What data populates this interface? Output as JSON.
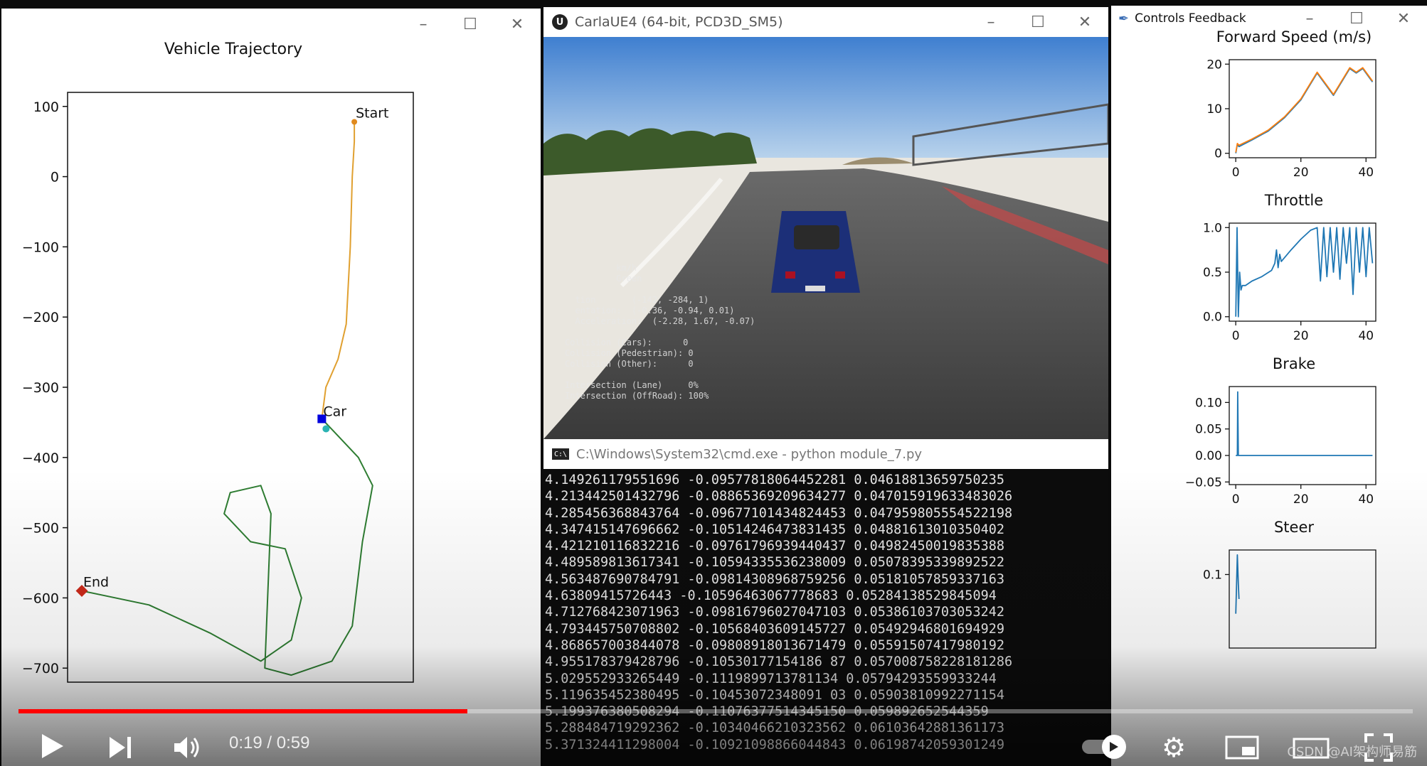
{
  "trajectory_window": {
    "chart_data": {
      "type": "line",
      "title": "Vehicle Trajectory",
      "xlim": [
        -125,
        45
      ],
      "ylim": [
        -720,
        120
      ],
      "yticks": [
        100,
        0,
        -100,
        -200,
        -300,
        -400,
        -500,
        -600,
        -700
      ],
      "tick_labels": [
        "100",
        "0",
        "−100",
        "−200",
        "−300",
        "−400",
        "−500",
        "−600",
        "−700"
      ],
      "annotations": {
        "start": "Start",
        "car": "Car",
        "end": "End"
      },
      "series": [
        {
          "color": "#2e7d32",
          "x": [
            -118,
            -85,
            -55,
            -30,
            -15,
            -10,
            -18,
            -35,
            -48,
            -45,
            -30,
            -25,
            -28,
            -15,
            5,
            15,
            20,
            25,
            18,
            5,
            0
          ],
          "y": [
            -590,
            -610,
            -650,
            -690,
            -660,
            -600,
            -530,
            -520,
            -480,
            -450,
            -440,
            -480,
            -700,
            -710,
            -690,
            -640,
            -520,
            -440,
            -400,
            -360,
            -345
          ]
        },
        {
          "color": "#e0a030",
          "x": [
            0,
            2,
            8,
            12,
            14,
            15,
            16,
            16
          ],
          "y": [
            -345,
            -300,
            -260,
            -210,
            -100,
            0,
            50,
            78
          ]
        }
      ],
      "start_point": [
        16,
        78
      ],
      "car_point": [
        0,
        -345
      ],
      "end_point": [
        -118,
        -590
      ]
    }
  },
  "carla_window": {
    "title": "CarlaUE4 (64-bit, PCD3D_SM5)",
    "logo": "U",
    "hud_lines": "          km/h\n          Green\n\n  tion       (-142, -284, 1)\n  entation:  (-0.36, -0.94, 0.01)\n  Acceleration:  (-2.28, 1.67, -0.07)\n\nCollision (Cars):      0\nCollision (Pedestrian): 0\nCollision (Other):      0\n\nIntersection (Lane)     0%\nIntersection (OffRoad): 100%"
  },
  "cmd_window": {
    "title": "C:\\Windows\\System32\\cmd.exe - python  module_7.py",
    "lines": [
      "4.149261179551696 -0.09577818064452281 0.04618813659750235",
      "4.213442501432796 -0.08865369209634277 0.047015919633483026",
      "4.285456368843764 -0.09677101434824453 0.047959805554522198",
      "4.347415147696662 -0.10514246473831435 0.04881613010350402",
      "4.421210116832216 -0.09761796939440437 0.04982450019835388",
      "4.489589813617341 -0.10594335536238009 0.05078395339892522",
      "4.563487690784791 -0.09814308968759256 0.05181057859337163",
      "4.63809415726443 -0.10596463067778683 0.05284138529845094",
      "4.712768423071963 -0.09816796027047103 0.05386103703053242",
      "4.793445750708802 -0.10568403609145727 0.05492946801694929",
      "4.868657003844078 -0.09808918013671479 0.05591507417980192",
      "4.955178379428796 -0.10530177154186 87 0.057008758228181286",
      "5.029552933265449 -0.1119899713781134 0.05794293559933244",
      "5.119635452380495 -0.10453072348091 03 0.05903810992271154",
      "5.199376380508294 -0.11076377514345150 0.059892652544359",
      "5.288484719292362 -0.10340466210323562 0.06103642881361173",
      "5.371324411298004 -0.10921098866044843 0.06198742059301249"
    ]
  },
  "feedback_window": {
    "title": "Controls Feedback",
    "charts": [
      {
        "type": "line",
        "title": "Forward Speed (m/s)",
        "xlim": [
          -2,
          43
        ],
        "ylim": [
          -1,
          21
        ],
        "xticks": [
          "0",
          "20",
          "40"
        ],
        "yticks": [
          "20",
          "10",
          "0"
        ],
        "ytick_values": [
          20,
          10,
          0
        ],
        "series": [
          {
            "color": "#1f77b4",
            "x": [
              0,
              0.5,
              1,
              5,
              10,
              15,
              20,
              25,
              30,
              35,
              37,
              39,
              41,
              42
            ],
            "y": [
              0,
              2,
              1.5,
              3,
              5,
              8,
              12,
              18,
              13,
              19,
              18,
              19,
              17,
              16
            ]
          },
          {
            "color": "#ff7f0e",
            "x": [
              0,
              0.5,
              1,
              5,
              10,
              15,
              20,
              25,
              30,
              35,
              37,
              39,
              41,
              42
            ],
            "y": [
              0.2,
              2.2,
              1.8,
              3.2,
              5.2,
              8.2,
              12.2,
              18.2,
              13.2,
              19.2,
              18.2,
              19.2,
              17.2,
              16.2
            ]
          }
        ]
      },
      {
        "type": "line",
        "title": "Throttle",
        "xlim": [
          -2,
          43
        ],
        "ylim": [
          -0.05,
          1.05
        ],
        "xticks": [
          "0",
          "20",
          "40"
        ],
        "yticks": [
          "1.0",
          "0.5",
          "0.0"
        ],
        "ytick_values": [
          1.0,
          0.5,
          0.0
        ],
        "series": [
          {
            "color": "#1f77b4",
            "x": [
              0,
              0.4,
              0.8,
              1.2,
              1.6,
              2,
              3,
              5,
              8,
              11,
              12,
              12.5,
              13,
              13.5,
              14,
              17,
              20,
              23,
              25,
              26,
              27,
              28,
              29,
              30,
              31,
              32,
              33,
              34,
              35,
              36,
              37,
              38,
              39,
              40,
              41,
              42
            ],
            "y": [
              0,
              1.0,
              0.0,
              0.5,
              0.3,
              0.35,
              0.35,
              0.4,
              0.45,
              0.52,
              0.6,
              0.75,
              0.55,
              0.7,
              0.62,
              0.75,
              0.87,
              0.97,
              1.0,
              0.4,
              1.0,
              0.45,
              1.0,
              0.5,
              1.0,
              0.42,
              1.0,
              0.6,
              1.0,
              0.25,
              1.0,
              0.5,
              1.0,
              0.45,
              1.0,
              0.6
            ]
          }
        ]
      },
      {
        "type": "line",
        "title": "Brake",
        "xlim": [
          -2,
          43
        ],
        "ylim": [
          -0.055,
          0.13
        ],
        "xticks": [
          "0",
          "20",
          "40"
        ],
        "yticks": [
          "0.10",
          "0.05",
          "0.00",
          "−0.05"
        ],
        "ytick_values": [
          0.1,
          0.05,
          0.0,
          -0.05
        ],
        "series": [
          {
            "color": "#1f77b4",
            "x": [
              0,
              0.5,
              0.6,
              0.8,
              1,
              42
            ],
            "y": [
              0,
              0,
              0.12,
              0.0,
              0,
              0
            ]
          }
        ]
      },
      {
        "type": "line",
        "title": "Steer",
        "xlim": [
          -2,
          43
        ],
        "ylim": [
          -0.05,
          0.15
        ],
        "xticks": [],
        "yticks": [
          "0.1"
        ],
        "ytick_values": [
          0.1
        ],
        "series": [
          {
            "color": "#1f77b4",
            "x": [
              0,
              0.5,
              0.8,
              1
            ],
            "y": [
              0.02,
              0.14,
              0.08,
              0.05
            ]
          }
        ]
      }
    ]
  },
  "video": {
    "time_label": "0:19 / 0:59",
    "progress": 0.322,
    "watermark": "CSDN @AI架构师易筋"
  }
}
